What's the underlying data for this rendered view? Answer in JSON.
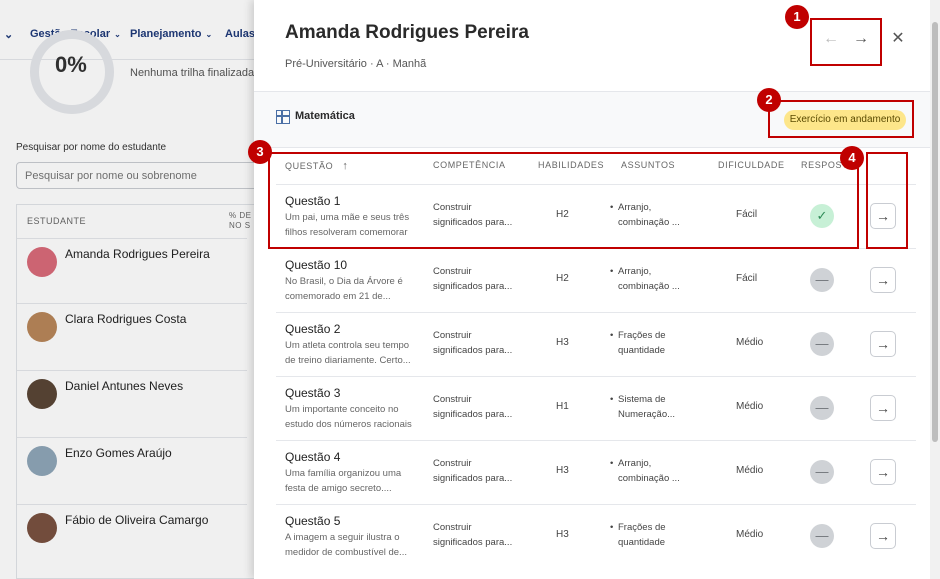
{
  "nav": {
    "items": [
      "Gestão Escolar",
      "Planejamento",
      "Aulas"
    ]
  },
  "background": {
    "progress_value": "0%",
    "no_trail_text": "Nenhuma trilha finalizada",
    "search_label": "Pesquisar por nome do estudante",
    "search_placeholder": "Pesquisar por nome ou sobrenome",
    "table_header_student": "ESTUDANTE",
    "table_header_pct": "% DE\nNO S",
    "students": [
      {
        "name": "Amanda Rodrigues Pereira",
        "avatar_color": "#d96b7a"
      },
      {
        "name": "Clara Rodrigues Costa",
        "avatar_color": "#b8865a"
      },
      {
        "name": "Daniel Antunes Neves",
        "avatar_color": "#5a4636"
      },
      {
        "name": "Enzo Gomes Araújo",
        "avatar_color": "#8fa6b8"
      },
      {
        "name": "Fábio de Oliveira Camargo",
        "avatar_color": "#7a5140"
      }
    ]
  },
  "drawer": {
    "student_name": "Amanda Rodrigues Pereira",
    "student_class": "Pré-Universitário · A · Manhã",
    "prev_icon": "←",
    "next_icon": "→",
    "close_icon": "✕",
    "subject": "Matemática",
    "status": "Exercício em andamento",
    "columns": {
      "question": "QUESTÃO",
      "question_sort_icon": "↑",
      "competence": "COMPETÊNCIA",
      "skills": "HABILIDADES",
      "topics": "ASSUNTOS",
      "difficulty": "DIFICULDADE",
      "answer": "RESPOSTA"
    },
    "questions": [
      {
        "title": "Questão 1",
        "desc": "Um pai, uma mãe e seus três filhos resolveram comemorar",
        "competence": "Construir significados para...",
        "skill": "H2",
        "topic": "Arranjo, combinação ...",
        "difficulty": "Fácil",
        "answer_icon": "✓",
        "answer_state": "ok",
        "go_icon": "→"
      },
      {
        "title": "Questão 10",
        "desc": "No Brasil, o Dia da Árvore é comemorado em 21 de...",
        "competence": "Construir significados para...",
        "skill": "H2",
        "topic": "Arranjo, combinação ...",
        "difficulty": "Fácil",
        "answer_icon": "—",
        "answer_state": "none",
        "go_icon": "→"
      },
      {
        "title": "Questão 2",
        "desc": "Um atleta controla seu tempo de treino diariamente. Certo...",
        "competence": "Construir significados para...",
        "skill": "H3",
        "topic": "Frações de quantidade",
        "difficulty": "Médio",
        "answer_icon": "—",
        "answer_state": "none",
        "go_icon": "→"
      },
      {
        "title": "Questão 3",
        "desc": "Um importante conceito no estudo dos números racionais",
        "competence": "Construir significados para...",
        "skill": "H1",
        "topic": "Sistema de Numeração...",
        "difficulty": "Médio",
        "answer_icon": "—",
        "answer_state": "none",
        "go_icon": "→"
      },
      {
        "title": "Questão 4",
        "desc": "Uma família organizou uma festa de amigo secreto....",
        "competence": "Construir significados para...",
        "skill": "H3",
        "topic": "Arranjo, combinação ...",
        "difficulty": "Médio",
        "answer_icon": "—",
        "answer_state": "none",
        "go_icon": "→"
      },
      {
        "title": "Questão 5",
        "desc": "A imagem a seguir ilustra o medidor de combustível de...",
        "competence": "Construir significados para...",
        "skill": "H3",
        "topic": "Frações de quantidade",
        "difficulty": "Médio",
        "answer_icon": "—",
        "answer_state": "none",
        "go_icon": "→"
      }
    ]
  },
  "callouts": [
    "1",
    "2",
    "3",
    "4"
  ]
}
